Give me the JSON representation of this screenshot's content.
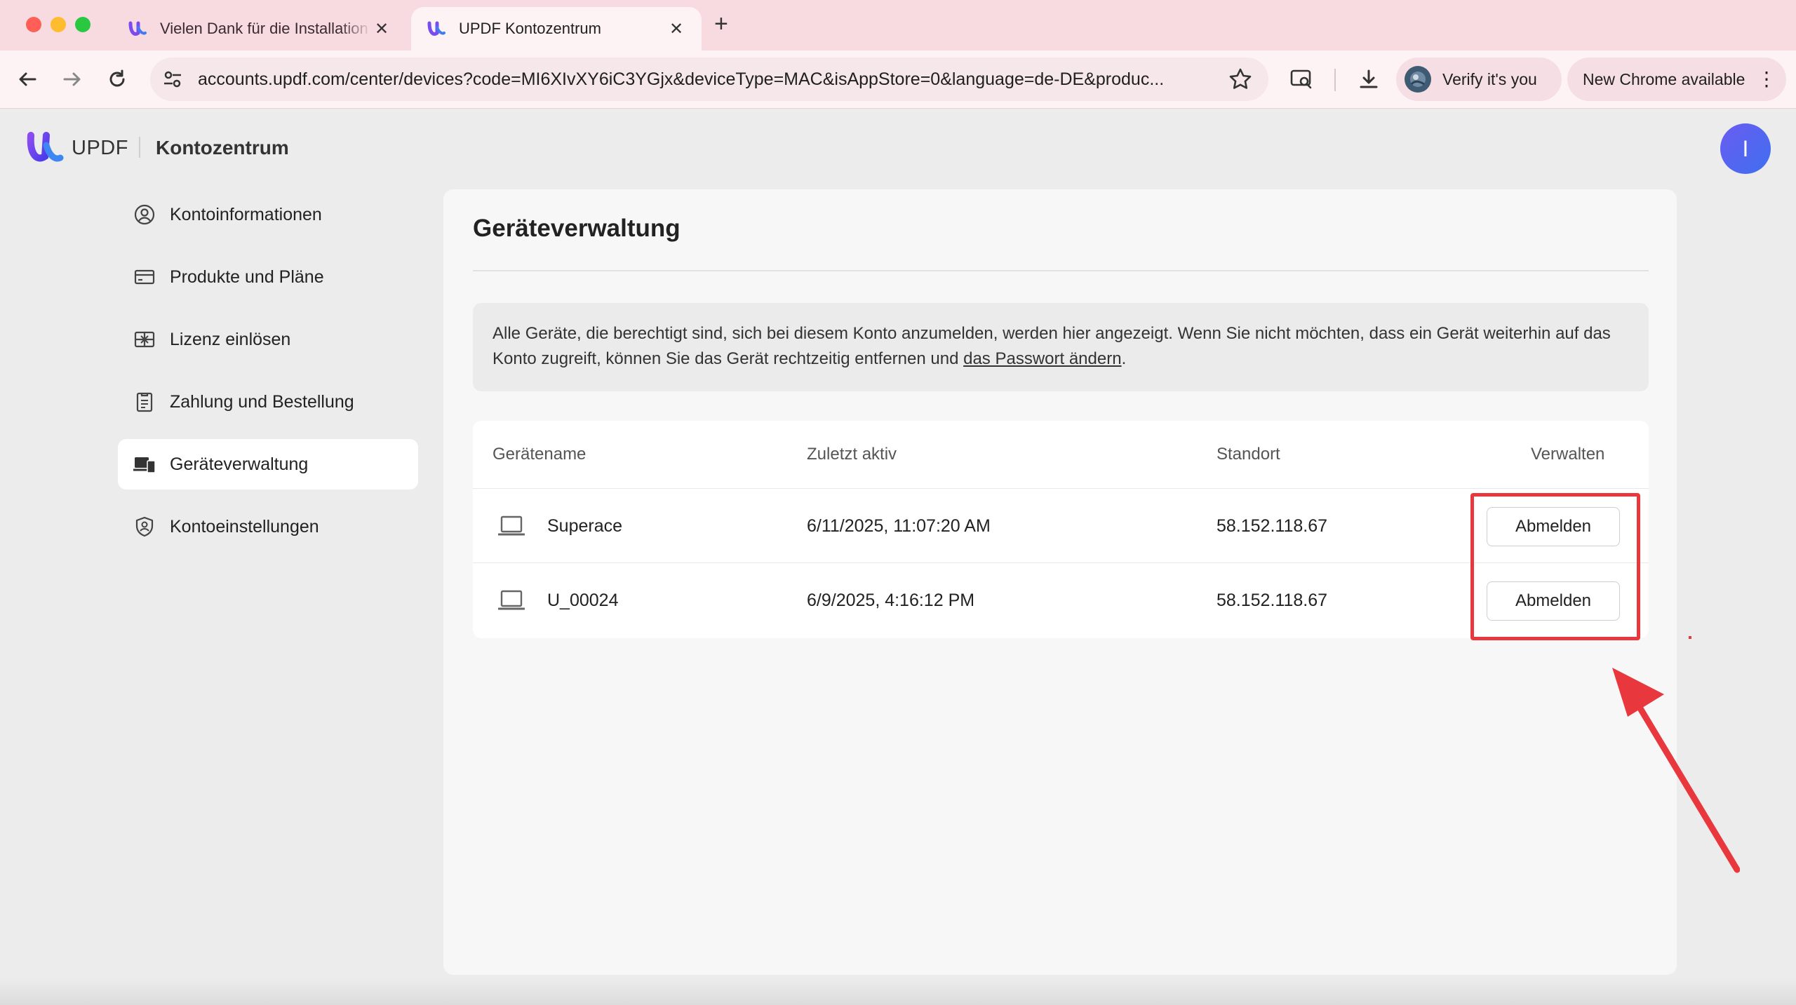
{
  "browser": {
    "tabs": [
      {
        "title": "Vielen Dank für die Installation",
        "active": false
      },
      {
        "title": "UPDF Kontozentrum",
        "active": true
      }
    ],
    "url": "accounts.updf.com/center/devices?code=MI6XIvXY6iC3YGjx&deviceType=MAC&isAppStore=0&language=de-DE&produc...",
    "verify_chip": "Verify it's you",
    "new_chrome_chip": "New Chrome available"
  },
  "header": {
    "brand": "UPDF",
    "section": "Kontozentrum",
    "avatar_initial": "I"
  },
  "sidebar": {
    "items": [
      {
        "label": "Kontoinformationen",
        "icon": "user-circle-icon",
        "active": false
      },
      {
        "label": "Produkte und Pläne",
        "icon": "card-icon",
        "active": false
      },
      {
        "label": "Lizenz einlösen",
        "icon": "gift-icon",
        "active": false
      },
      {
        "label": "Zahlung und Bestellung",
        "icon": "clipboard-icon",
        "active": false
      },
      {
        "label": "Geräteverwaltung",
        "icon": "devices-icon",
        "active": true
      },
      {
        "label": "Kontoeinstellungen",
        "icon": "shield-user-icon",
        "active": false
      }
    ]
  },
  "main": {
    "title": "Geräteverwaltung",
    "notice_text": "Alle Geräte, die berechtigt sind, sich bei diesem Konto anzumelden, werden hier angezeigt. Wenn Sie nicht möchten, dass ein Gerät weiterhin auf das Konto zugreift, können Sie das Gerät rechtzeitig entfernen und ",
    "notice_link": "das Passwort ändern",
    "notice_end": ".",
    "table": {
      "columns": [
        "Gerätename",
        "Zuletzt aktiv",
        "Standort",
        "Verwalten"
      ],
      "rows": [
        {
          "name": "Superace",
          "last_active": "6/11/2025, 11:07:20 AM",
          "location": "58.152.118.67",
          "action": "Abmelden"
        },
        {
          "name": "U_00024",
          "last_active": "6/9/2025, 4:16:12 PM",
          "location": "58.152.118.67",
          "action": "Abmelden"
        }
      ]
    }
  },
  "colors": {
    "annotation_red": "#e8383d",
    "tab_bar": "#f8dbe1",
    "page_bg": "#ececec"
  }
}
